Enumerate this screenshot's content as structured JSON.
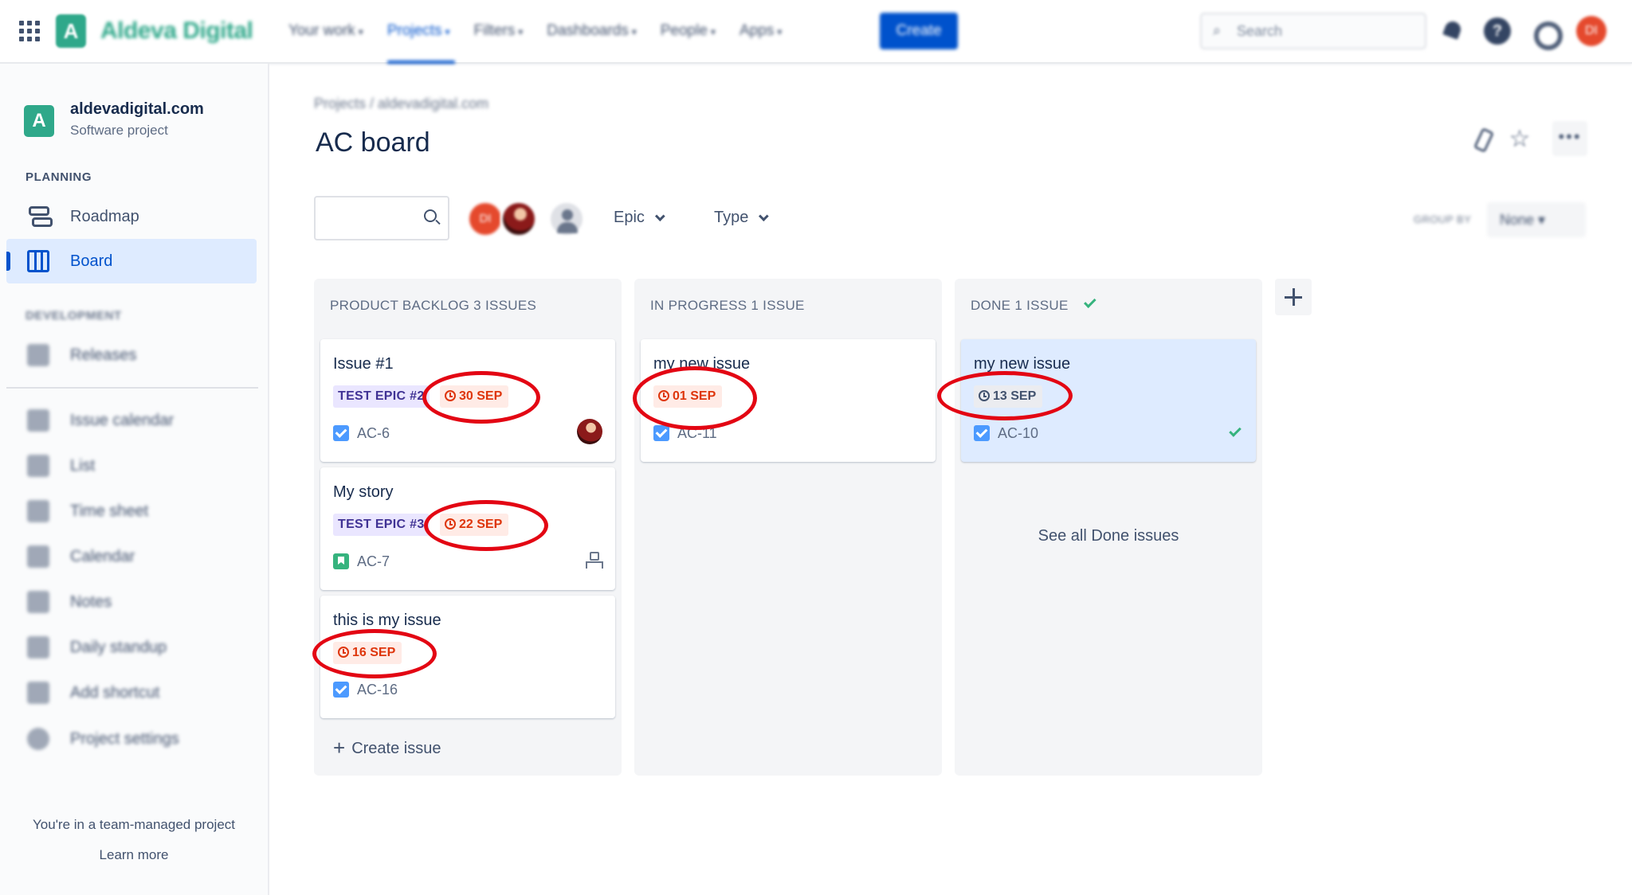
{
  "topnav": {
    "logo_letter": "A",
    "brand": "Aldeva Digital",
    "items": [
      {
        "label": "Your work",
        "active": false
      },
      {
        "label": "Projects",
        "active": true
      },
      {
        "label": "Filters",
        "active": false
      },
      {
        "label": "Dashboards",
        "active": false
      },
      {
        "label": "People",
        "active": false
      },
      {
        "label": "Apps",
        "active": false
      }
    ],
    "create_label": "Create",
    "search_placeholder": "Search",
    "help_glyph": "?",
    "profile_initials": "DI"
  },
  "sidebar": {
    "project_letter": "A",
    "project_name": "aldevadigital.com",
    "project_type": "Software project",
    "planning_label": "PLANNING",
    "planning_items": [
      {
        "label": "Roadmap",
        "icon": "roadmap-icon"
      },
      {
        "label": "Board",
        "icon": "board-icon",
        "active": true
      }
    ],
    "development_label": "DEVELOPMENT",
    "development_items": [
      {
        "label": "Releases",
        "icon": "ship-icon"
      }
    ],
    "extra_items": [
      {
        "label": "Issue calendar",
        "icon": "calendar-icon"
      },
      {
        "label": "List",
        "icon": "list-icon"
      },
      {
        "label": "Time sheet",
        "icon": "timesheet-icon"
      },
      {
        "label": "Calendar",
        "icon": "calendar-icon"
      },
      {
        "label": "Notes",
        "icon": "notes-icon"
      },
      {
        "label": "Daily standup",
        "icon": "clipboard-icon"
      },
      {
        "label": "Add shortcut",
        "icon": "add-shortcut-icon"
      },
      {
        "label": "Project settings",
        "icon": "gear-icon"
      }
    ],
    "footer_text": "You're in a team-managed project",
    "learn_more": "Learn more"
  },
  "main": {
    "breadcrumb": "Projects  /  aldevadigital.com",
    "title": "AC board",
    "more_glyph": "•••",
    "star_glyph": "☆",
    "filters": {
      "avatar_initials": "DI",
      "epic_label": "Epic",
      "type_label": "Type",
      "group_by_label": "GROUP BY",
      "group_by_value": "None ▾"
    }
  },
  "board": {
    "columns": [
      {
        "title": "PRODUCT BACKLOG 3 ISSUES",
        "cards": [
          {
            "title": "Issue #1",
            "epic": "TEST EPIC #2",
            "due": "30 SEP",
            "key": "AC-6",
            "type": "task"
          },
          {
            "title": "My story",
            "epic": "TEST EPIC #3",
            "due": "22 SEP",
            "key": "AC-7",
            "type": "story"
          },
          {
            "title": "this is my issue",
            "due": "16 SEP",
            "key": "AC-16",
            "type": "task"
          }
        ],
        "create_label": "Create issue"
      },
      {
        "title": "IN PROGRESS 1 ISSUE",
        "cards": [
          {
            "title": "my new issue",
            "due": "01 SEP",
            "key": "AC-11",
            "type": "task"
          }
        ]
      },
      {
        "title": "DONE 1 ISSUE",
        "cards": [
          {
            "title": "my new issue",
            "due": "13 SEP",
            "key": "AC-10",
            "type": "task"
          }
        ],
        "see_all_label": "See all Done issues"
      }
    ]
  },
  "colors": {
    "brand": "#2fa88a",
    "primary": "#0052cc",
    "overdue": "#de350b",
    "annotation": "#e30613"
  }
}
